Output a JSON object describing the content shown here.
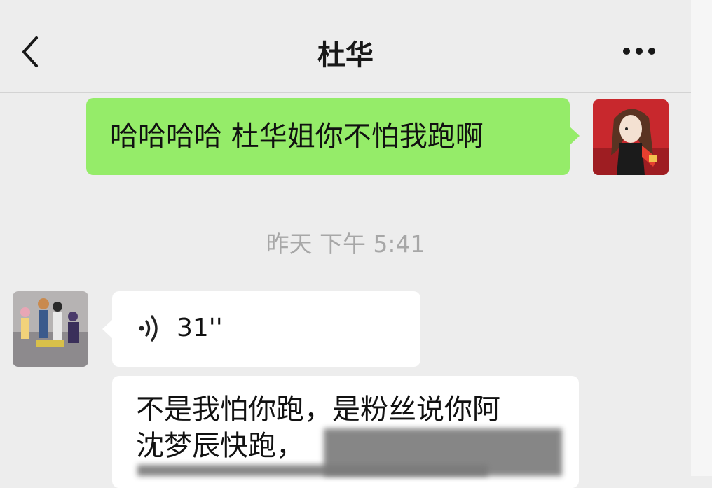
{
  "header": {
    "title": "杜华",
    "back_icon": "chevron-left-icon",
    "more_icon": "ellipsis-icon"
  },
  "messages": [
    {
      "side": "self",
      "type": "text",
      "text": "哈哈哈哈 杜华姐你不怕我跑啊"
    },
    {
      "type": "timestamp",
      "text": "昨天 下午 5:41"
    },
    {
      "side": "other",
      "type": "voice",
      "duration": "31''",
      "icon": "voice-wave-icon"
    },
    {
      "side": "other",
      "type": "text",
      "lines": [
        "不是我怕你跑，是粉丝说你阿",
        "沈梦辰快跑，"
      ]
    }
  ],
  "colors": {
    "self_bubble": "#95ec69",
    "other_bubble": "#ffffff",
    "background": "#ededed",
    "timestamp_text": "#a7a7a7"
  }
}
